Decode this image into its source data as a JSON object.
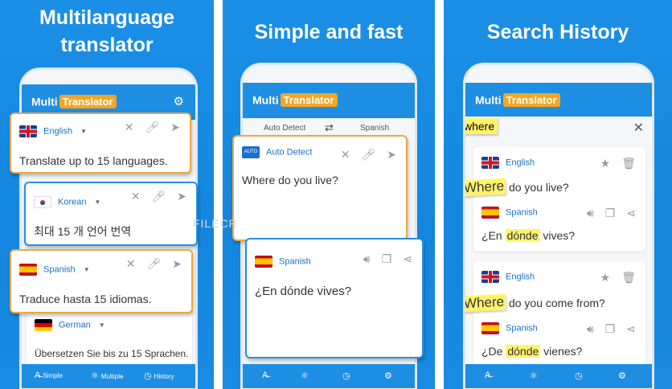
{
  "panels": [
    {
      "title_line1": "Multilanguage",
      "title_line2": "translator",
      "brand_multi": "Multi",
      "brand_tr": "Translator",
      "cards": [
        {
          "lang": "English",
          "text": "Translate up to 15 languages."
        },
        {
          "lang": "Korean",
          "text": "최대 15 개 언어 번역"
        },
        {
          "lang": "Spanish",
          "text": "Traduce hasta 15 idiomas."
        },
        {
          "lang": "German",
          "text": "Übersetzen Sie bis zu 15 Sprachen."
        }
      ],
      "nav": [
        "Simple",
        "Multiple",
        "History"
      ]
    },
    {
      "title": "Simple and fast",
      "brand_multi": "Multi",
      "brand_tr": "Translator",
      "source_lang": "Auto Detect",
      "target_lang": "Spanish",
      "input_lang": "Auto Detect",
      "input_text": "Where do you live?",
      "output_lang": "Spanish",
      "output_text": "¿En dónde vives?"
    },
    {
      "title": "Search History",
      "brand_multi": "Multi",
      "brand_tr": "Translator",
      "search_value": "where",
      "history": [
        {
          "src_lang": "English",
          "src_hl": "Where",
          "src_rest": " do you live?",
          "dst_lang": "Spanish",
          "dst_pre": "¿En ",
          "dst_hl": "dónde",
          "dst_post": " vives?"
        },
        {
          "src_lang": "English",
          "src_hl": "Where",
          "src_rest": " do you come from?",
          "dst_lang": "Spanish",
          "dst_pre": "¿De ",
          "dst_hl": "dónde",
          "dst_post": " vienes?"
        }
      ]
    }
  ],
  "watermark": "FILECR",
  "colors": {
    "primary": "#1e8ee3",
    "accent": "#f5a623",
    "highlight": "#fff36b"
  }
}
